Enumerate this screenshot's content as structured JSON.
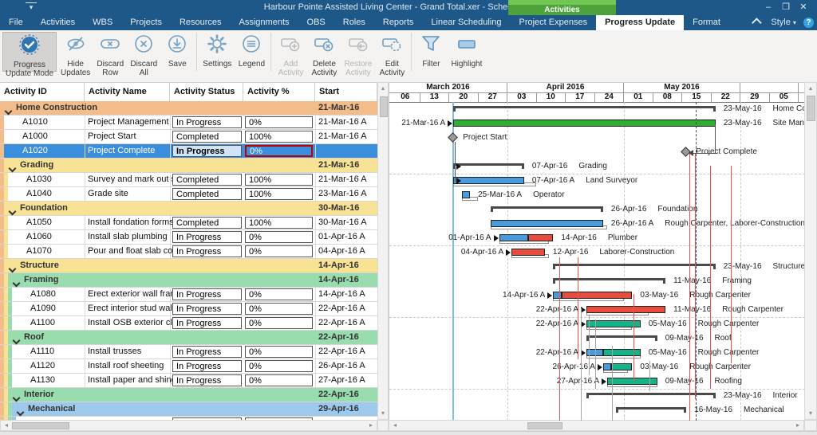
{
  "window": {
    "title": "Harbour Pointe Assisted Living Center - Grand Total.xer - ScheduleReader",
    "contextual_tab": "Activities",
    "controls": {
      "minimize": "–",
      "maximize": "❐",
      "close": "✕"
    }
  },
  "menu": {
    "tabs": [
      {
        "label": "File"
      },
      {
        "label": "Activities"
      },
      {
        "label": "WBS"
      },
      {
        "label": "Projects"
      },
      {
        "label": "Resources"
      },
      {
        "label": "Assignments"
      },
      {
        "label": "OBS"
      },
      {
        "label": "Roles"
      },
      {
        "label": "Reports"
      },
      {
        "label": "Linear Scheduling"
      },
      {
        "label": "Project Expenses"
      },
      {
        "label": "Progress Update",
        "selected": true
      },
      {
        "label": "Format"
      }
    ],
    "right": {
      "style_label": "Style",
      "help_label": "?"
    }
  },
  "ribbon": {
    "group_label": "Progress Update",
    "items": [
      {
        "label": "Progress\nUpdate Mode",
        "icon": "progress-update-mode-icon",
        "state": "active"
      },
      {
        "label": "Hide\nUpdates",
        "icon": "hide-updates-icon"
      },
      {
        "label": "Discard\nRow",
        "icon": "discard-row-icon"
      },
      {
        "label": "Discard\nAll",
        "icon": "discard-all-icon"
      },
      {
        "label": "Save",
        "icon": "save-icon"
      },
      {
        "divider": true
      },
      {
        "label": "Settings",
        "icon": "settings-icon"
      },
      {
        "label": "Legend",
        "icon": "legend-icon"
      },
      {
        "divider": true
      },
      {
        "label": "Add\nActivity",
        "icon": "add-activity-icon",
        "state": "disabled"
      },
      {
        "label": "Delete\nActivity",
        "icon": "delete-activity-icon"
      },
      {
        "label": "Restore\nActivity",
        "icon": "restore-activity-icon",
        "state": "disabled"
      },
      {
        "label": "Edit\nActivity",
        "icon": "edit-activity-icon"
      },
      {
        "divider": true
      },
      {
        "label": "Filter",
        "icon": "filter-icon"
      },
      {
        "label": "Highlight",
        "icon": "highlight-icon"
      }
    ]
  },
  "table": {
    "columns": [
      "Activity ID",
      "Activity Name",
      "Activity Status",
      "Activity % Complete",
      "Start"
    ],
    "rows": [
      {
        "type": "group",
        "level": 0,
        "name": "Home Construction",
        "start": "21-Mar-16"
      },
      {
        "type": "activity",
        "level": 1,
        "id": "A1010",
        "name": "Project Management",
        "status": "In Progress",
        "pct": "0%",
        "start": "21-Mar-16 A"
      },
      {
        "type": "activity",
        "level": 1,
        "id": "A1000",
        "name": "Project Start",
        "status": "Completed",
        "pct": "100%",
        "start": "21-Mar-16 A"
      },
      {
        "type": "activity",
        "level": 1,
        "id": "A1020",
        "name": "Project Complete",
        "status": "In Progress",
        "pct": "0%",
        "start": "",
        "selected": true
      },
      {
        "type": "group",
        "level": 1,
        "name": "Grading",
        "start": "21-Mar-16"
      },
      {
        "type": "activity",
        "level": 2,
        "id": "A1030",
        "name": "Survey and mark out site",
        "status": "Completed",
        "pct": "100%",
        "start": "21-Mar-16 A"
      },
      {
        "type": "activity",
        "level": 2,
        "id": "A1040",
        "name": "Grade site",
        "status": "Completed",
        "pct": "100%",
        "start": "23-Mar-16 A"
      },
      {
        "type": "group",
        "level": 1,
        "name": "Foundation",
        "start": "30-Mar-16"
      },
      {
        "type": "activity",
        "level": 2,
        "id": "A1050",
        "name": "Install fondation forms",
        "status": "Completed",
        "pct": "100%",
        "start": "30-Mar-16 A"
      },
      {
        "type": "activity",
        "level": 2,
        "id": "A1060",
        "name": "Install slab plumbing",
        "status": "In Progress",
        "pct": "0%",
        "start": "01-Apr-16 A"
      },
      {
        "type": "activity",
        "level": 2,
        "id": "A1070",
        "name": "Pour and float slab concrete",
        "status": "In Progress",
        "pct": "0%",
        "start": "04-Apr-16 A"
      },
      {
        "type": "group",
        "level": 1,
        "name": "Structure",
        "start": "14-Apr-16"
      },
      {
        "type": "group",
        "level": 2,
        "name": "Framing",
        "start": "14-Apr-16"
      },
      {
        "type": "activity",
        "level": 3,
        "id": "A1080",
        "name": "Erect exterior wall frames",
        "status": "In Progress",
        "pct": "0%",
        "start": "14-Apr-16 A"
      },
      {
        "type": "activity",
        "level": 3,
        "id": "A1090",
        "name": "Erect interior stud walls",
        "status": "In Progress",
        "pct": "0%",
        "start": "22-Apr-16 A"
      },
      {
        "type": "activity",
        "level": 3,
        "id": "A1100",
        "name": "Install OSB exterior cladding",
        "status": "In Progress",
        "pct": "0%",
        "start": "22-Apr-16 A"
      },
      {
        "type": "group",
        "level": 2,
        "name": "Roof",
        "start": "22-Apr-16"
      },
      {
        "type": "activity",
        "level": 3,
        "id": "A1110",
        "name": "Install trusses",
        "status": "In Progress",
        "pct": "0%",
        "start": "22-Apr-16 A"
      },
      {
        "type": "activity",
        "level": 3,
        "id": "A1120",
        "name": "Install roof sheeting",
        "status": "In Progress",
        "pct": "0%",
        "start": "26-Apr-16 A"
      },
      {
        "type": "activity",
        "level": 3,
        "id": "A1130",
        "name": "Install paper and shingles",
        "status": "In Progress",
        "pct": "0%",
        "start": "27-Apr-16 A"
      },
      {
        "type": "group",
        "level": 2,
        "name": "Interior",
        "start": "22-Apr-16"
      },
      {
        "type": "group",
        "level": 3,
        "name": "Mechanical",
        "start": "29-Apr-16"
      }
    ]
  },
  "gantt": {
    "months": [
      {
        "label": "March 2016",
        "weeks": 4
      },
      {
        "label": "April 2016",
        "weeks": 4
      },
      {
        "label": "May 2016",
        "weeks": 4
      },
      {
        "label": "",
        "weeks": 2
      }
    ],
    "weeks": [
      "06",
      "13",
      "20",
      "27",
      "03",
      "10",
      "17",
      "24",
      "01",
      "08",
      "15",
      "22",
      "29",
      "05"
    ],
    "rows": [
      {
        "kind": "summary",
        "s": 15,
        "e": 78,
        "date": "23-May-16",
        "name": "Home Construction"
      },
      {
        "kind": "bar",
        "segs": [
          {
            "s": 15,
            "e": 78,
            "c": "green"
          }
        ],
        "left": "21-Mar-16 A",
        "date": "23-May-16",
        "name": "Site Manager"
      },
      {
        "kind": "milestone",
        "d": 15,
        "name": "Project Start"
      },
      {
        "kind": "milestone",
        "d": 71,
        "name": "Project Complete"
      },
      {
        "kind": "summary",
        "s": 15,
        "e": 32,
        "date": "07-Apr-16",
        "name": "Grading"
      },
      {
        "kind": "bar",
        "segs": [
          {
            "s": 15,
            "e": 32,
            "c": "blue"
          }
        ],
        "base": {
          "s": 15,
          "e": 35
        },
        "date": "07-Apr-16 A",
        "name": "Land Surveyor"
      },
      {
        "kind": "bar",
        "segs": [
          {
            "s": 17,
            "e": 19,
            "c": "blue"
          }
        ],
        "base": {
          "s": 17,
          "e": 21
        },
        "date": "25-Mar-16 A",
        "name": "Operator"
      },
      {
        "kind": "summary",
        "s": 24,
        "e": 51,
        "date": "26-Apr-16",
        "name": "Foundation"
      },
      {
        "kind": "bar",
        "segs": [
          {
            "s": 24,
            "e": 51,
            "c": "blue"
          }
        ],
        "base": {
          "s": 24,
          "e": 52
        },
        "date": "26-Apr-16 A",
        "name": "Rough Carpenter, Laborer-Construction"
      },
      {
        "kind": "bar",
        "segs": [
          {
            "s": 26,
            "e": 33,
            "c": "blue"
          },
          {
            "s": 33,
            "e": 39,
            "c": "red"
          }
        ],
        "base": {
          "s": 26,
          "e": 38
        },
        "left": "01-Apr-16 A",
        "date": "14-Apr-16",
        "name": "Plumber"
      },
      {
        "kind": "bar",
        "segs": [
          {
            "s": 29,
            "e": 37,
            "c": "red"
          }
        ],
        "base": {
          "s": 29,
          "e": 38
        },
        "left": "04-Apr-16 A",
        "date": "12-Apr-16",
        "name": "Laborer-Construction"
      },
      {
        "kind": "summary",
        "s": 39,
        "e": 78,
        "date": "23-May-16",
        "name": "Structure"
      },
      {
        "kind": "summary",
        "s": 39,
        "e": 66,
        "date": "11-May-16",
        "name": "Framing"
      },
      {
        "kind": "bar",
        "segs": [
          {
            "s": 39,
            "e": 41,
            "c": "blue"
          },
          {
            "s": 41,
            "e": 58,
            "c": "red"
          }
        ],
        "base": {
          "s": 39,
          "e": 56
        },
        "left": "14-Apr-16 A",
        "date": "03-May-16",
        "name": "Rough Carpenter"
      },
      {
        "kind": "bar",
        "segs": [
          {
            "s": 47,
            "e": 66,
            "c": "red"
          }
        ],
        "base": {
          "s": 47,
          "e": 62
        },
        "left": "22-Apr-16 A",
        "date": "11-May-16",
        "name": "Rough Carpenter"
      },
      {
        "kind": "bar",
        "segs": [
          {
            "s": 47,
            "e": 60,
            "c": "teal"
          }
        ],
        "base": {
          "s": 47,
          "e": 58
        },
        "left": "22-Apr-16 A",
        "date": "05-May-16",
        "name": "Rough Carpenter"
      },
      {
        "kind": "summary",
        "s": 47,
        "e": 64,
        "date": "09-May-16",
        "name": "Roof"
      },
      {
        "kind": "bar",
        "segs": [
          {
            "s": 47,
            "e": 51,
            "c": "blue"
          },
          {
            "s": 51,
            "e": 60,
            "c": "teal"
          }
        ],
        "base": {
          "s": 47,
          "e": 60
        },
        "left": "22-Apr-16 A",
        "date": "05-May-16",
        "name": "Rough Carpenter"
      },
      {
        "kind": "bar",
        "segs": [
          {
            "s": 51,
            "e": 53,
            "c": "blue"
          },
          {
            "s": 53,
            "e": 58,
            "c": "teal"
          }
        ],
        "base": {
          "s": 51,
          "e": 57
        },
        "left": "26-Apr-16 A",
        "date": "03-May-16",
        "name": "Rough Carpenter"
      },
      {
        "kind": "bar",
        "segs": [
          {
            "s": 52,
            "e": 64,
            "c": "teal"
          }
        ],
        "base": {
          "s": 52,
          "e": 64
        },
        "left": "27-Apr-16 A",
        "date": "09-May-16",
        "name": "Roofing"
      },
      {
        "kind": "summary",
        "s": 47,
        "e": 78,
        "date": "23-May-16",
        "name": "Interior"
      },
      {
        "kind": "summary",
        "s": 54,
        "e": 71,
        "date": "16-May-16",
        "name": "Mechanical"
      }
    ]
  },
  "colors": {
    "titlebar": "#1d5888",
    "contextual_green": "#4ea23c",
    "selected_row": "#3a8edc",
    "group_level_colors": [
      "#f3bd8b",
      "#f8e294",
      "#99dcae",
      "#9dc9ed"
    ],
    "bar_green": "#2eae32",
    "bar_blue": "#4a9ade",
    "bar_red": "#e74c3f",
    "bar_teal": "#16b389",
    "summary_bar": "#4a4a4a",
    "data_date_line": "#7fbce8",
    "critical_link": "#e05a52",
    "pct_cell_border": "#c00000",
    "status_cell_selected_bg": "#cfe4f7"
  }
}
